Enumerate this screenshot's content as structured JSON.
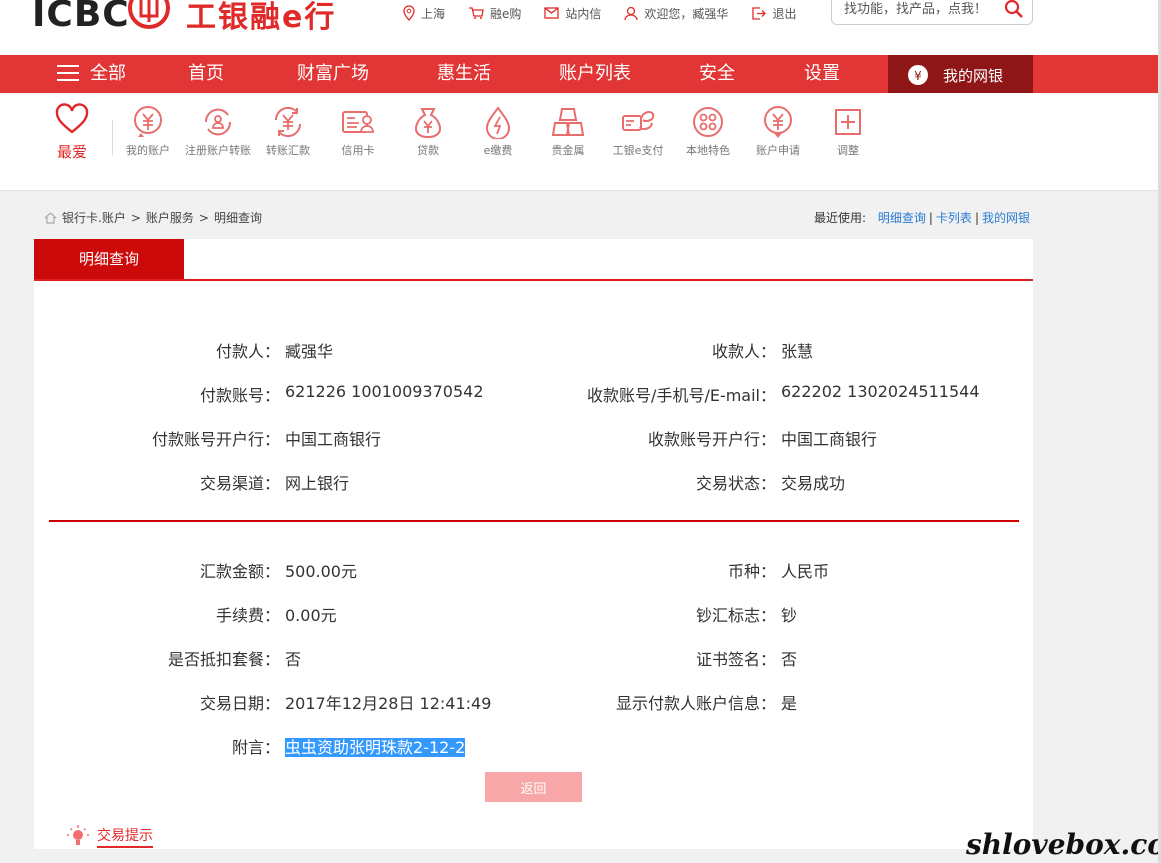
{
  "header": {
    "logo_text": "ICBC",
    "logo_cn": "工银融e行",
    "links": [
      {
        "icon": "location-icon",
        "label": "上海"
      },
      {
        "icon": "cart-icon",
        "label": "融e购"
      },
      {
        "icon": "mail-icon",
        "label": "站内信"
      },
      {
        "icon": "user-icon",
        "label": "欢迎您，臧强华"
      },
      {
        "icon": "logout-icon",
        "label": "退出"
      }
    ],
    "search_placeholder": "找功能，找产品，点我！"
  },
  "nav": {
    "all_label": "全部",
    "items": [
      "首页",
      "财富广场",
      "惠生活",
      "账户列表",
      "安全",
      "设置"
    ],
    "mine_label": "我的网银"
  },
  "quick": {
    "fav_label": "最爱",
    "items": [
      {
        "icon": "account-icon",
        "label": "我的账户"
      },
      {
        "icon": "register-transfer-icon",
        "label": "注册账户转账"
      },
      {
        "icon": "transfer-icon",
        "label": "转账汇款"
      },
      {
        "icon": "credit-card-icon",
        "label": "信用卡"
      },
      {
        "icon": "loan-icon",
        "label": "贷款"
      },
      {
        "icon": "epay-bill-icon",
        "label": "e缴费"
      },
      {
        "icon": "metal-icon",
        "label": "贵金属"
      },
      {
        "icon": "e-pay-icon",
        "label": "工银e支付"
      },
      {
        "icon": "local-icon",
        "label": "本地特色"
      },
      {
        "icon": "apply-icon",
        "label": "账户申请"
      },
      {
        "icon": "adjust-icon",
        "label": "调整"
      }
    ]
  },
  "breadcrumb": {
    "items": [
      "银行卡.账户",
      "账户服务",
      "明细查询"
    ],
    "sep": ">",
    "recent_label": "最近使用:",
    "recent_links": [
      "明细查询",
      "卡列表",
      "我的网银"
    ]
  },
  "panel": {
    "tab_label": "明细查询",
    "left_rows": [
      {
        "label": "付款人：",
        "value": "臧强华"
      },
      {
        "label": "付款账号：",
        "value": "621226 1001009370542"
      },
      {
        "label": "付款账号开户行：",
        "value": "中国工商银行"
      },
      {
        "label": "交易渠道：",
        "value": "网上银行"
      }
    ],
    "right_rows": [
      {
        "label": "收款人：",
        "value": "张慧"
      },
      {
        "label": "收款账号/手机号/E-mail：",
        "value": "622202 1302024511544"
      },
      {
        "label": "收款账号开户行：",
        "value": "中国工商银行"
      },
      {
        "label": "交易状态：",
        "value": "交易成功"
      }
    ],
    "left_rows2": [
      {
        "label": "汇款金额：",
        "value": "500.00元"
      },
      {
        "label": "手续费：",
        "value": "0.00元"
      },
      {
        "label": "是否抵扣套餐：",
        "value": "否"
      },
      {
        "label": "交易日期：",
        "value": "2017年12月28日 12:41:49"
      },
      {
        "label": "附言：",
        "value": "虫虫资助张明珠款2-12-2"
      }
    ],
    "right_rows2": [
      {
        "label": "币种：",
        "value": "人民币"
      },
      {
        "label": "钞汇标志：",
        "value": "钞"
      },
      {
        "label": "证书签名：",
        "value": "否"
      },
      {
        "label": "显示付款人账户信息：",
        "value": "是"
      }
    ],
    "back_label": "返回"
  },
  "tips": {
    "label": "交易提示"
  },
  "watermark": "shlovebox.com",
  "colors": {
    "brand_red": "#e23535",
    "dark_red": "#8f1616",
    "tab_red": "#cc0a0a",
    "link_blue": "#2a7bd3"
  }
}
